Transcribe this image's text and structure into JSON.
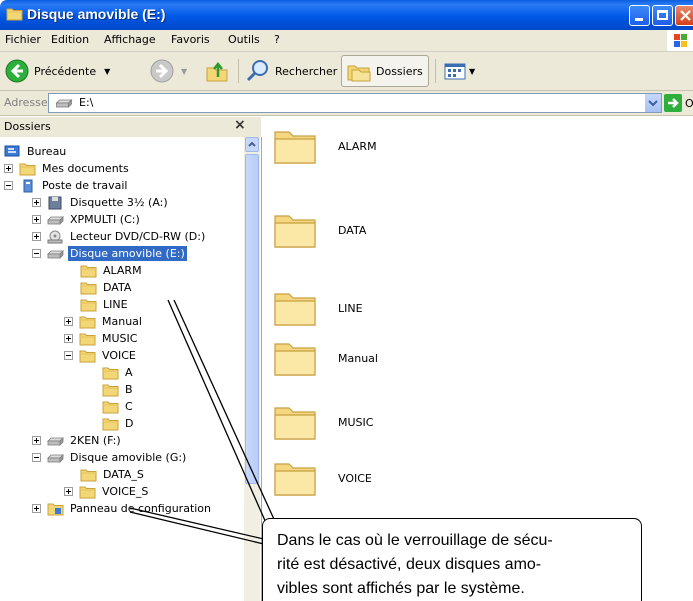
{
  "window": {
    "title": "Disque amovible (E:)"
  },
  "menu": [
    "Fichier",
    "Edition",
    "Affichage",
    "Favoris",
    "Outils",
    "?"
  ],
  "toolbar": {
    "back": "Précédente",
    "search": "Rechercher",
    "folders": "Dossiers"
  },
  "address": {
    "label": "Adresse",
    "value": "E:\\",
    "go": "OK"
  },
  "folder_pane": {
    "title": "Dossiers",
    "close": "×",
    "tree": [
      {
        "label": "Bureau"
      },
      {
        "label": "Mes documents"
      },
      {
        "label": "Poste de travail"
      },
      {
        "label": "Disquette 3½ (A:)"
      },
      {
        "label": "XPMULTI (C:)"
      },
      {
        "label": "Lecteur DVD/CD-RW (D:)"
      },
      {
        "label": "Disque amovible (E:)"
      },
      {
        "label": "ALARM"
      },
      {
        "label": "DATA"
      },
      {
        "label": "LINE"
      },
      {
        "label": "Manual"
      },
      {
        "label": "MUSIC"
      },
      {
        "label": "VOICE"
      },
      {
        "label": "A"
      },
      {
        "label": "B"
      },
      {
        "label": "C"
      },
      {
        "label": "D"
      },
      {
        "label": "2KEN (F:)"
      },
      {
        "label": "Disque amovible (G:)"
      },
      {
        "label": "DATA_S"
      },
      {
        "label": "VOICE_S"
      },
      {
        "label": "Panneau de configuration"
      }
    ]
  },
  "content": {
    "folders": [
      "ALARM",
      "DATA",
      "LINE",
      "Manual",
      "MUSIC",
      "VOICE"
    ]
  },
  "callout": {
    "lines": [
      "Dans le cas où le verrouillage de sécu-",
      "rité est désactivé, deux disques amo-",
      "vibles sont affichés par le système."
    ]
  },
  "colors": {
    "titlebar": "#0058e6",
    "chrome": "#ece9d8",
    "selection": "#316ac5",
    "folder": "#f4d77e"
  }
}
